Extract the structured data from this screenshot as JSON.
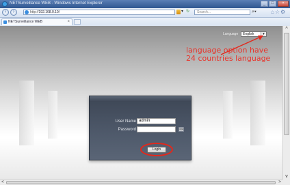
{
  "window": {
    "title": "NETSurveillance WEB - Windows Internet Explorer",
    "min_label": "_",
    "max_label": "□",
    "close_label": "×"
  },
  "address": {
    "scheme": "http://",
    "host": "192.168.0.10/",
    "search_placeholder": "Search..."
  },
  "tab": {
    "label": "NETSurveillance WEB",
    "close_label": "×"
  },
  "language": {
    "label": "Language",
    "selected": "English"
  },
  "annotation": {
    "line1": "language option have",
    "line2": "24 countries language",
    "color": "#e8332a"
  },
  "login": {
    "username_label": "User Name",
    "username_value": "admin",
    "password_label": "Password",
    "password_value": "",
    "button_label": "Login"
  },
  "icons": {
    "back": "back-arrow-icon",
    "forward": "forward-arrow-icon",
    "refresh": "refresh-icon",
    "search": "search-icon",
    "home": "home-icon",
    "favorites": "star-icon",
    "tools": "gear-icon",
    "keyboard": "keyboard-icon"
  }
}
